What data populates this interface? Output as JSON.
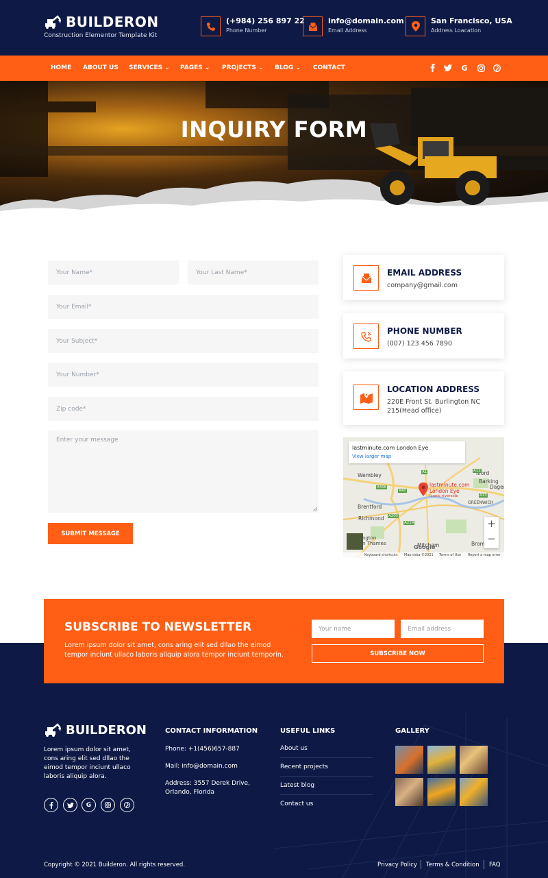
{
  "header": {
    "logo_name": "BUILDERON",
    "logo_tagline": "Construction Elementor Template Kit",
    "contacts": [
      {
        "main": "(+984) 256 897 22",
        "sub": "Phone Number",
        "icon": "phone-icon"
      },
      {
        "main": "info@domain.com",
        "sub": "Email Address",
        "icon": "envelope-icon"
      },
      {
        "main": "San Francisco, USA",
        "sub": "Address Loacation",
        "icon": "map-pin-icon"
      }
    ]
  },
  "nav": {
    "items": [
      "HOME",
      "ABOUT US",
      "SERVICES",
      "PAGES",
      "PROJECTS",
      "BLOG",
      "CONTACT"
    ],
    "social": [
      "facebook-icon",
      "twitter-icon",
      "google-icon",
      "instagram-icon",
      "pinterest-icon"
    ]
  },
  "hero": {
    "title": "INQUIRY FORM"
  },
  "form": {
    "first_name": "Your Name*",
    "last_name": "Your Last Name*",
    "email": "Your Email*",
    "subject": "Your Subject*",
    "number": "Your Number*",
    "zip": "Zip code*",
    "message": "Enter your message",
    "submit": "SUBMIT MESSAGE"
  },
  "info": {
    "email": {
      "title": "EMAIL ADDRESS",
      "text": "company@gmail.com"
    },
    "phone": {
      "title": "PHONE NUMBER",
      "text": "(007) 123 456 7890"
    },
    "location": {
      "title": "LOCATION ADDRESS",
      "line1": "220E Front St. Burlington NC",
      "line2": "215(Head office)"
    }
  },
  "map": {
    "place": "lastminute.com London Eye",
    "larger": "View larger map",
    "marker_name": "lastminute.com",
    "marker_name2": "London Eye",
    "marker_sub": "Iconic riverside",
    "labels": [
      "Wembley",
      "Ilford",
      "Barking",
      "Dagen",
      "GREENWICH",
      "Brentford",
      "Richmond",
      "ngton",
      "n Thames",
      "Mitcham",
      "Bromley"
    ],
    "roads": [
      "A1",
      "A12",
      "A406",
      "A13",
      "A40",
      "A205",
      "A214"
    ],
    "footer_links": [
      "Keyboard shortcuts",
      "Map data ©2021",
      "Terms of Use",
      "Report a map error"
    ],
    "brand": "Google",
    "zoom_in": "+",
    "zoom_out": "−"
  },
  "newsletter": {
    "title": "SUBSCRIBE TO NEWSLETTER",
    "text": "Lorem ipsum dolor sit amet, cons aring elit sed dllao the eimod tempor inciunt ullaco laboris aliquip alora tempor inciunt temporin.",
    "name_placeholder": "Your name",
    "email_placeholder": "Email address",
    "button": "SUBSCRIBE NOW"
  },
  "footer": {
    "logo_name": "BUILDERON",
    "about": "Lorem ipsum dolor sit amet, cons aring elit sed dllao the eimod tempor inciunt ullaco laboris aliquip alora.",
    "contact_title": "CONTACT INFORMATION",
    "phone": "Phone: +1(456)657-887",
    "mail": "Mail: info@domain.com",
    "address": "Address: 3557 Derek Drive, Orlando, Florida",
    "links_title": "USEFUL LINKS",
    "links": [
      "About us",
      "Recent projects",
      "Latest blog",
      "Contact us"
    ],
    "gallery_title": "GALLERY",
    "copyright": "Copyright © 2021 Builderon. All rights reserved.",
    "bottom_links": [
      "Privacy Policy",
      "Terms & Condition",
      "FAQ"
    ]
  },
  "colors": {
    "accent": "#ff5e14",
    "navy": "#0e1a45"
  }
}
